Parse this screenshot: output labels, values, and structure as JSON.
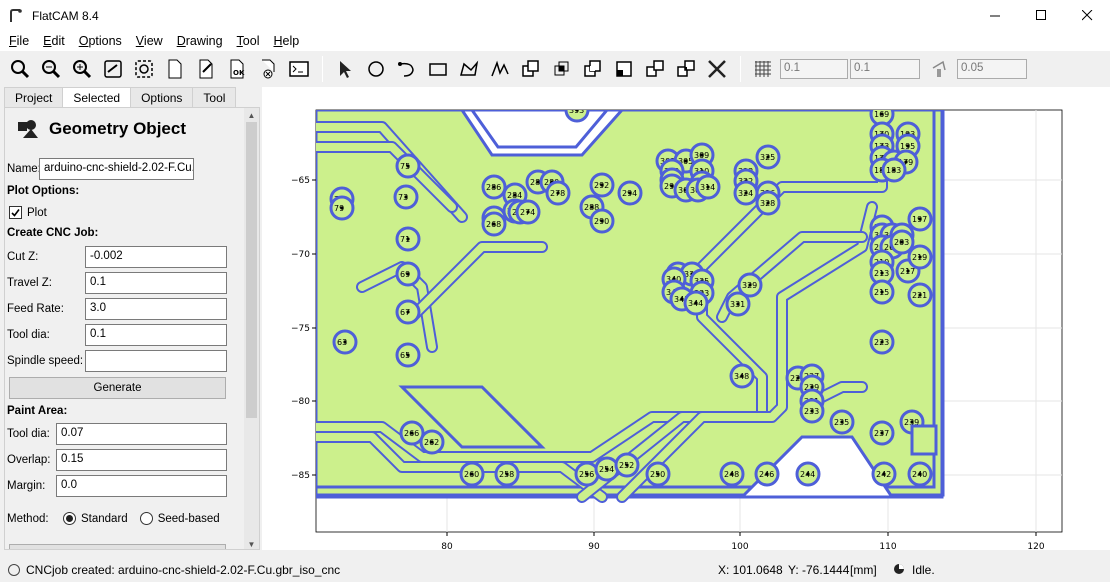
{
  "window": {
    "title": "FlatCAM 8.4"
  },
  "menu": [
    "File",
    "Edit",
    "Options",
    "View",
    "Drawing",
    "Tool",
    "Help"
  ],
  "toolbar": {
    "icons": [
      "zoom-fit-icon",
      "zoom-in-icon",
      "zoom-out-icon",
      "replot-icon",
      "clear-plot-icon",
      "new-geometry-icon",
      "editor-icon",
      "update-object-icon",
      "delete-icon",
      "shell-icon",
      "select-icon",
      "circle-icon",
      "arc-icon",
      "rectangle-icon",
      "polygon-icon",
      "path-icon",
      "union-icon",
      "intersection-icon",
      "subtraction-icon",
      "cut-icon",
      "buffer-icon",
      "paint-icon",
      "delete-shape-icon",
      "grid-snap-icon",
      "corner-snap-icon"
    ],
    "grid_x": "0.1",
    "grid_y": "0.1",
    "snap_max": "0.05"
  },
  "tabs": [
    "Project",
    "Selected",
    "Options",
    "Tool"
  ],
  "active_tab": "Selected",
  "panel": {
    "header": "Geometry Object",
    "name_label": "Name:",
    "name_value": "arduino-cnc-shield-2.02-F.Cu.gbr_iso",
    "plot_options": "Plot Options:",
    "plot_label": "Plot",
    "plot_checked": true,
    "cnc_title": "Create CNC Job:",
    "cut_z_label": "Cut Z:",
    "cut_z": "-0.002",
    "travel_z_label": "Travel Z:",
    "travel_z": "0.1",
    "feed_rate_label": "Feed Rate:",
    "feed_rate": "3.0",
    "tool_dia_label": "Tool dia:",
    "tool_dia": "0.1",
    "spindle_label": "Spindle speed:",
    "spindle": "",
    "generate": "Generate",
    "paint_title": "Paint Area:",
    "paint_tool_dia_label": "Tool dia:",
    "paint_tool_dia": "0.07",
    "overlap_label": "Overlap:",
    "overlap": "0.15",
    "margin_label": "Margin:",
    "margin": "0.0",
    "method_label": "Method:",
    "method_standard": "Standard",
    "method_seed": "Seed-based",
    "method_selected": "Standard"
  },
  "plot": {
    "x_ticks": [
      "80",
      "90",
      "100",
      "110",
      "120"
    ],
    "y_ticks": [
      "−65",
      "−70",
      "−75",
      "−80",
      "−85"
    ],
    "colors": {
      "copper": "#ccf08c",
      "isolation": "#4e5fd8",
      "drill": "#000000"
    },
    "pad_labels": [
      "393",
      "169",
      "170",
      "193",
      "173",
      "175",
      "177",
      "179",
      "181",
      "183",
      "185",
      "187",
      "189",
      "191",
      "195",
      "75",
      "73",
      "71",
      "69",
      "67",
      "65",
      "63",
      "61",
      "78",
      "79",
      "286",
      "284",
      "276",
      "272",
      "270",
      "274",
      "269",
      "268",
      "282",
      "280",
      "278",
      "292",
      "294",
      "288",
      "290",
      "303",
      "305",
      "301",
      "309",
      "307",
      "300",
      "298",
      "296",
      "302",
      "304",
      "310",
      "312",
      "314",
      "316",
      "318",
      "323",
      "325",
      "322",
      "324",
      "328",
      "326",
      "197",
      "199",
      "201",
      "203",
      "205",
      "207",
      "209",
      "211",
      "213",
      "215",
      "217",
      "219",
      "221",
      "223",
      "339",
      "337",
      "340",
      "335",
      "333",
      "342",
      "341",
      "344",
      "329",
      "331",
      "348",
      "225",
      "227",
      "229",
      "231",
      "233",
      "235",
      "237",
      "239",
      "266",
      "262",
      "260",
      "258",
      "256",
      "254",
      "252",
      "250",
      "248",
      "246",
      "244",
      "242",
      "240"
    ]
  },
  "status": {
    "message": "CNCjob created: arduino-cnc-shield-2.02-F.Cu.gbr_iso_cnc",
    "x": "X: 101.0648",
    "y": "Y: -76.1444",
    "unit": "[mm]",
    "state": "Idle."
  }
}
